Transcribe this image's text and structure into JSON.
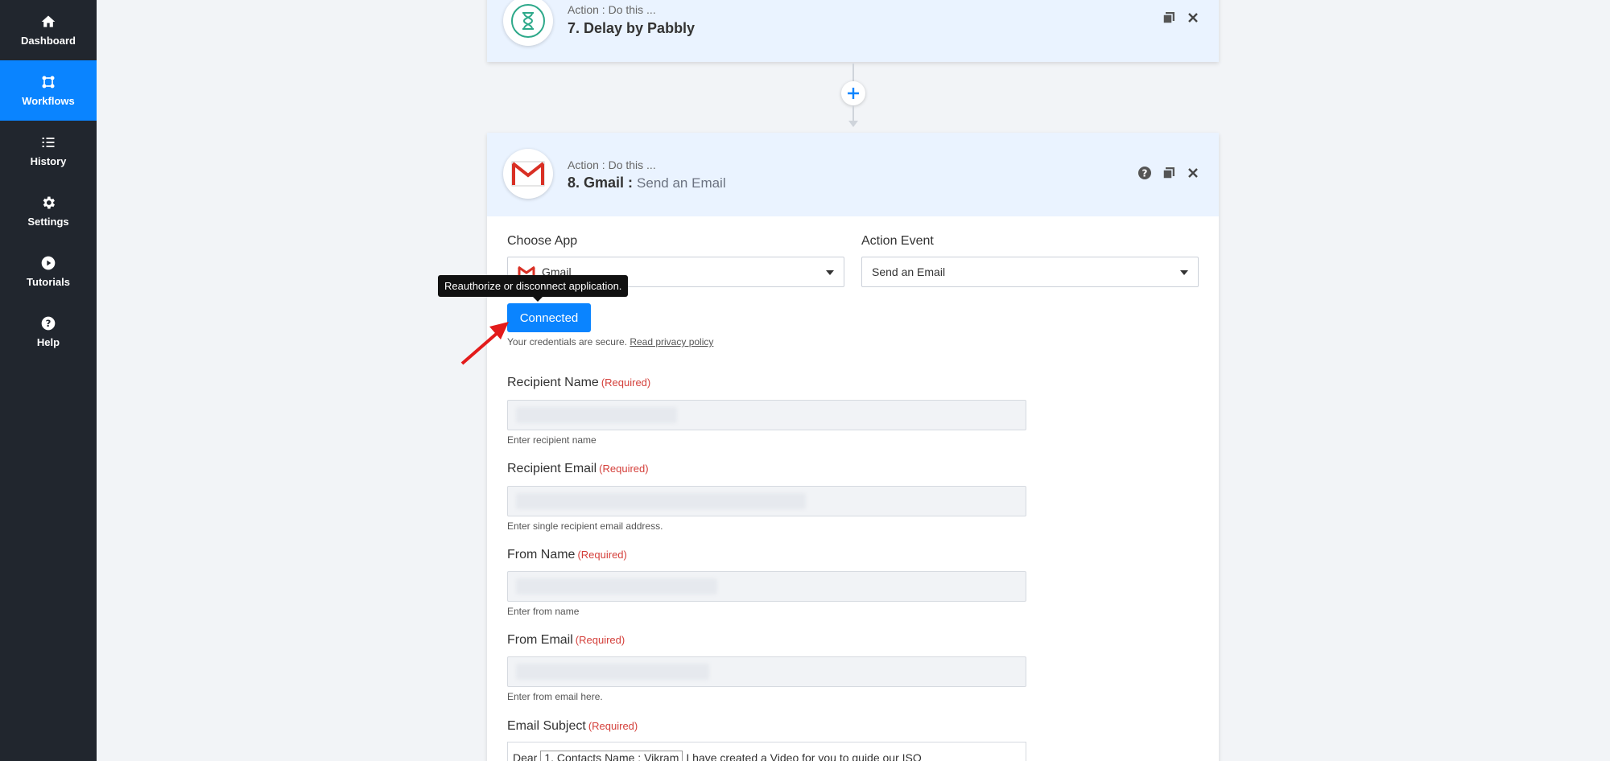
{
  "sidebar": {
    "items": [
      {
        "label": "Dashboard",
        "icon": "home-icon"
      },
      {
        "label": "Workflows",
        "icon": "workflow-icon",
        "active": true
      },
      {
        "label": "History",
        "icon": "history-icon"
      },
      {
        "label": "Settings",
        "icon": "gear-icon"
      },
      {
        "label": "Tutorials",
        "icon": "play-icon"
      },
      {
        "label": "Help",
        "icon": "help-icon"
      }
    ]
  },
  "step7": {
    "kicker": "Action : Do this ...",
    "title": "7. Delay by Pabbly",
    "icon": "hourglass-icon"
  },
  "step8": {
    "kicker": "Action : Do this ...",
    "title": "8. Gmail :",
    "subtitle": "Send an Email",
    "icon": "gmail-icon"
  },
  "form": {
    "choose_app_label": "Choose App",
    "choose_app_value": "Gmail",
    "action_event_label": "Action Event",
    "action_event_value": "Send an Email",
    "connected_label": "Connected",
    "tooltip": "Reauthorize or disconnect application.",
    "secure_text": "Your credentials are secure.",
    "privacy_link": "Read privacy policy",
    "required_tag": "(Required)",
    "recipient_name_label": "Recipient Name",
    "recipient_name_hint": "Enter recipient name",
    "recipient_email_label": "Recipient Email",
    "recipient_email_hint": "Enter single recipient email address.",
    "from_name_label": "From Name",
    "from_name_hint": "Enter from name",
    "from_email_label": "From Email",
    "from_email_hint": "Enter from email here.",
    "email_subject_label": "Email Subject",
    "subject_prefix": "Dear",
    "subject_token": "1. Contacts Name : Vikram",
    "subject_suffix": "I have created a Video for you to guide our ISO"
  },
  "colors": {
    "sidebar_bg": "#21262e",
    "accent": "#0a84ff",
    "required": "#d43f3a"
  }
}
